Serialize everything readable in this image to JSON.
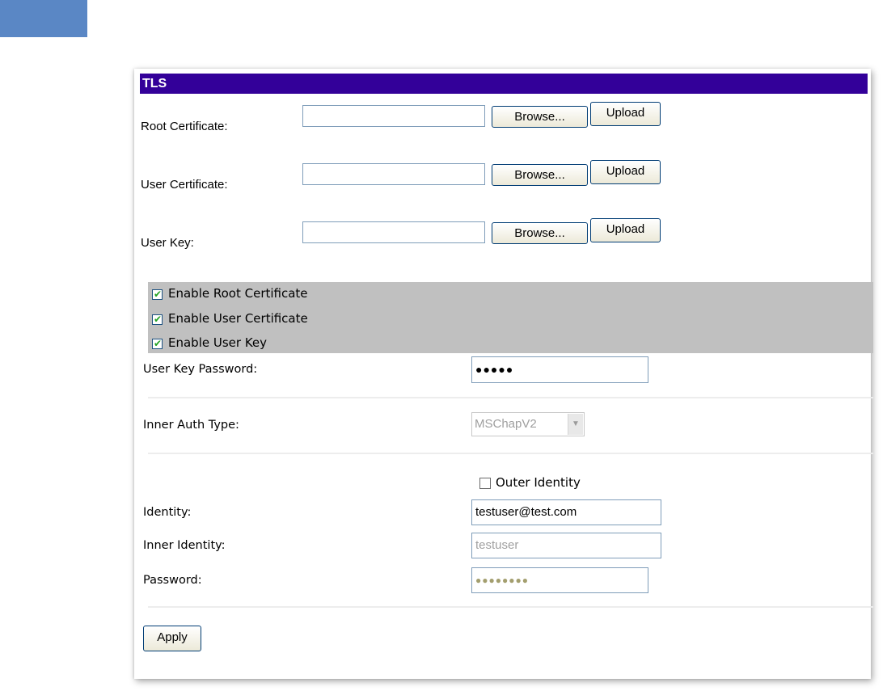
{
  "panel": {
    "title": "TLS",
    "files": [
      {
        "label": "Root Certificate:",
        "browse": "Browse...",
        "upload": "Upload"
      },
      {
        "label": "User Certificate:",
        "browse": "Browse...",
        "upload": "Upload"
      },
      {
        "label": "User Key:",
        "browse": "Browse...",
        "upload": "Upload"
      }
    ],
    "enable": [
      {
        "label": "Enable Root Certificate",
        "checked": true
      },
      {
        "label": "Enable User Certificate",
        "checked": true
      },
      {
        "label": "Enable User Key",
        "checked": true
      }
    ],
    "user_key_password": {
      "label": "User Key Password:",
      "value": "●●●●●"
    },
    "inner_auth": {
      "label": "Inner Auth Type:",
      "value": "MSChapV2"
    },
    "outer_identity": {
      "label": "Outer Identity",
      "checked": false
    },
    "identity": {
      "label": "Identity:",
      "value": "testuser@test.com"
    },
    "inner_identity": {
      "label": "Inner Identity:",
      "value": "testuser"
    },
    "password": {
      "label": "Password:",
      "value": "●●●●●●●●"
    },
    "apply": "Apply"
  },
  "colors": {
    "title_bar": "#330099",
    "band": "#c0c0c0",
    "top_tab": "#5a87c5"
  }
}
